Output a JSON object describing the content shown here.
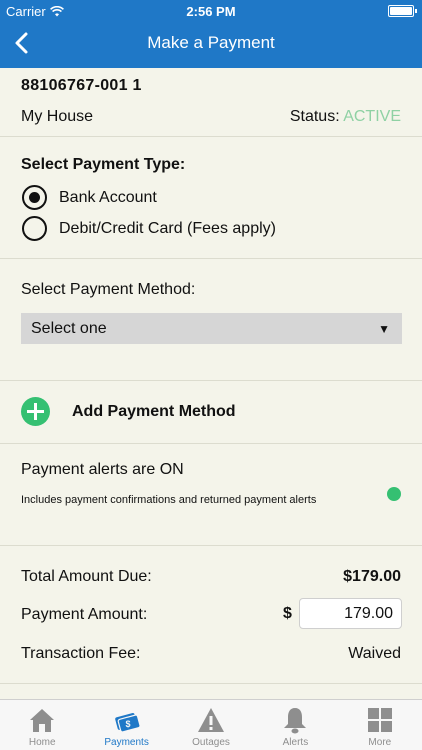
{
  "status_bar": {
    "carrier": "Carrier",
    "time": "2:56 PM"
  },
  "nav": {
    "title": "Make a Payment"
  },
  "account": {
    "number": "88106767-001 1",
    "name": "My House",
    "status_label": "Status:",
    "status_value": "ACTIVE"
  },
  "payment_type": {
    "title": "Select Payment Type:",
    "options": [
      {
        "label": "Bank Account",
        "selected": true
      },
      {
        "label": "Debit/Credit Card (Fees apply)",
        "selected": false
      }
    ]
  },
  "payment_method": {
    "label": "Select Payment Method:",
    "select_value": "Select one",
    "add_label": "Add Payment Method"
  },
  "alerts": {
    "title": "Payment alerts are ON",
    "description": "Includes payment confirmations and returned payment alerts"
  },
  "summary": {
    "total_label": "Total Amount Due:",
    "total_value": "$179.00",
    "payment_label": "Payment Amount:",
    "currency": "$",
    "payment_value": "179.00",
    "fee_label": "Transaction Fee:",
    "fee_value": "Waived"
  },
  "tabs": [
    {
      "label": "Home",
      "icon": "home-icon"
    },
    {
      "label": "Payments",
      "icon": "payments-icon"
    },
    {
      "label": "Outages",
      "icon": "warning-icon"
    },
    {
      "label": "Alerts",
      "icon": "bell-icon"
    },
    {
      "label": "More",
      "icon": "grid-icon"
    }
  ],
  "colors": {
    "header": "#1f78c7",
    "background": "#f4f4ea",
    "active_status": "#8fd1a4",
    "accent_green": "#35c072",
    "tab_active": "#1f78c7",
    "tab_inactive": "#8e8e8e"
  }
}
